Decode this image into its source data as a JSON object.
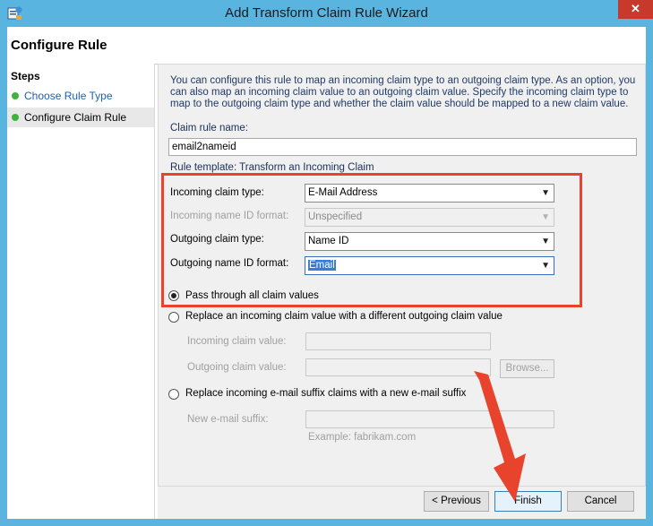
{
  "window": {
    "title": "Add Transform Claim Rule Wizard",
    "close_glyph": "✕",
    "app_icon": "adfs-wizard-icon"
  },
  "header": {
    "title": "Configure Rule"
  },
  "steps": {
    "heading": "Steps",
    "items": [
      {
        "label": "Choose Rule Type",
        "status": "complete"
      },
      {
        "label": "Configure Claim Rule",
        "status": "current"
      }
    ]
  },
  "main": {
    "description": "You can configure this rule to map an incoming claim type to an outgoing claim type. As an option, you can also map an incoming claim value to an outgoing claim value. Specify the incoming claim type to map to the outgoing claim type and whether the claim value should be mapped to a new claim value.",
    "claim_rule_name_label": "Claim rule name:",
    "claim_rule_name_value": "email2nameid",
    "rule_template": "Rule template: Transform an Incoming Claim",
    "incoming_claim_type_label": "Incoming claim type:",
    "incoming_claim_type_value": "E-Mail Address",
    "incoming_name_id_format_label": "Incoming name ID format:",
    "incoming_name_id_format_value": "Unspecified",
    "outgoing_claim_type_label": "Outgoing claim type:",
    "outgoing_claim_type_value": "Name ID",
    "outgoing_name_id_format_label": "Outgoing name ID format:",
    "outgoing_name_id_format_value": "Email",
    "radio_pass_through": "Pass through all claim values",
    "radio_replace_value": "Replace an incoming claim value with a different outgoing claim value",
    "incoming_claim_value_label": "Incoming claim value:",
    "outgoing_claim_value_label": "Outgoing claim value:",
    "browse_label": "Browse...",
    "radio_replace_suffix": "Replace incoming e-mail suffix claims with a new e-mail suffix",
    "new_suffix_label": "New e-mail suffix:",
    "example_text": "Example: fabrikam.com",
    "selected_option": "pass-through"
  },
  "buttons": {
    "previous": "< Previous",
    "finish": "Finish",
    "cancel": "Cancel"
  },
  "colors": {
    "frame": "#5ab4e0",
    "highlight_box": "#e8432c",
    "annotation_arrow": "#e8432c",
    "step_dot": "#3fb33c"
  }
}
